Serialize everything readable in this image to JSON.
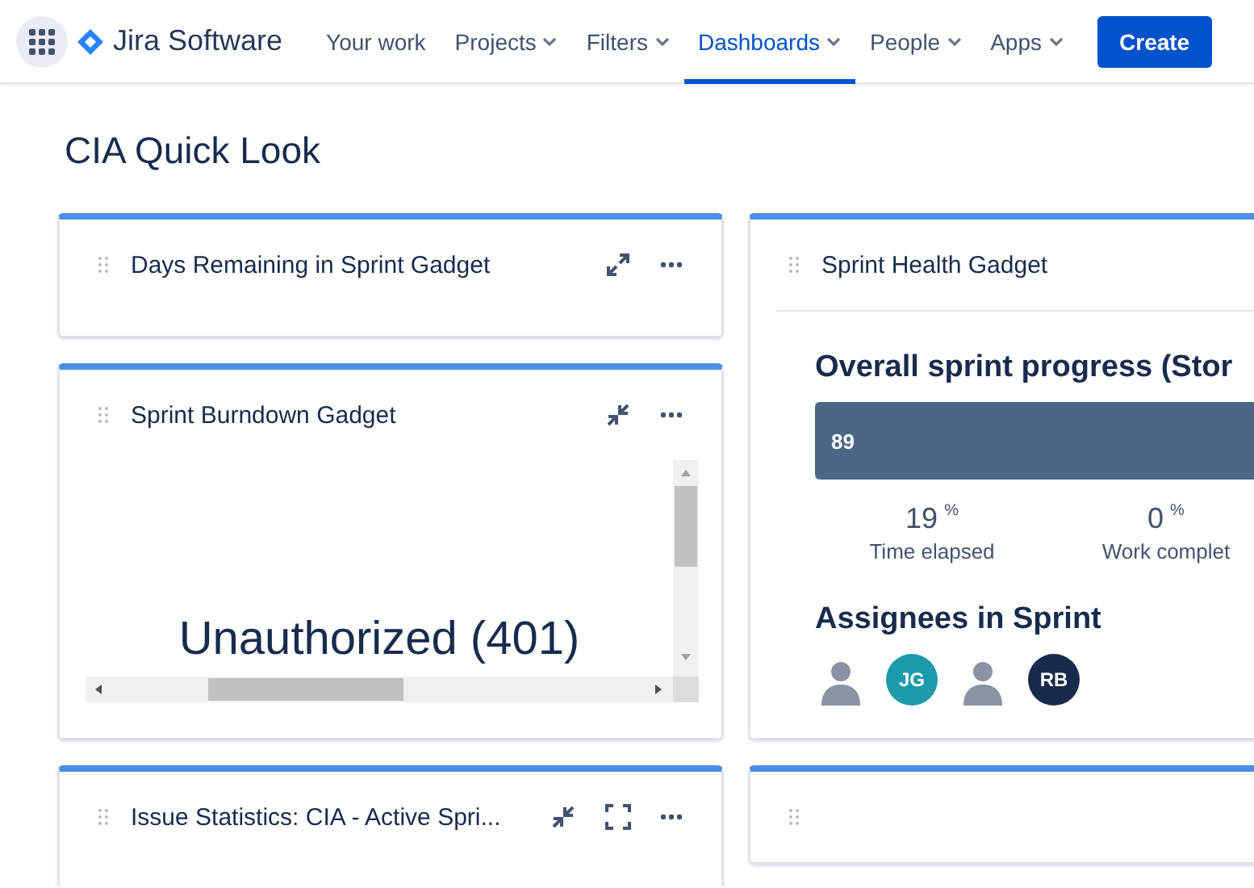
{
  "nav": {
    "product": "Jira Software",
    "items": [
      {
        "label": "Your work",
        "dropdown": false,
        "selected": false
      },
      {
        "label": "Projects",
        "dropdown": true,
        "selected": false
      },
      {
        "label": "Filters",
        "dropdown": true,
        "selected": false
      },
      {
        "label": "Dashboards",
        "dropdown": true,
        "selected": true
      },
      {
        "label": "People",
        "dropdown": true,
        "selected": false
      },
      {
        "label": "Apps",
        "dropdown": true,
        "selected": false
      }
    ],
    "create_button": "Create"
  },
  "page_title": "CIA Quick Look",
  "left_gadgets": [
    {
      "title": "Days Remaining in Sprint Gadget",
      "actions": [
        {
          "kind": "expand"
        },
        {
          "kind": "more"
        }
      ],
      "kind": "empty"
    },
    {
      "title": "Sprint Burndown Gadget",
      "actions": [
        {
          "kind": "collapse"
        },
        {
          "kind": "more"
        }
      ],
      "kind": "frame",
      "message": "Unauthorized (401)"
    },
    {
      "title": "Issue Statistics: CIA - Active Spri...",
      "actions": [
        {
          "kind": "collapse"
        },
        {
          "kind": "fullscreen"
        },
        {
          "kind": "more"
        }
      ],
      "kind": "empty"
    }
  ],
  "right_gadget": {
    "title": "Sprint Health Gadget",
    "progress_heading": "Overall sprint progress (Stor",
    "bar_label": "89",
    "level": 1,
    "stats": [
      {
        "value": "19",
        "unit": "%",
        "label": "Time elapsed"
      },
      {
        "value": "0",
        "unit": "%",
        "label": "Work complet"
      }
    ],
    "assignees_heading": "Assignees in Sprint",
    "assignees": [
      {
        "kind": "photo"
      },
      {
        "kind": "initials",
        "initials": "JG",
        "color": "#1d9aaa"
      },
      {
        "kind": "photo"
      },
      {
        "kind": "initials",
        "initials": "RB",
        "color": "#172b4d"
      }
    ]
  }
}
